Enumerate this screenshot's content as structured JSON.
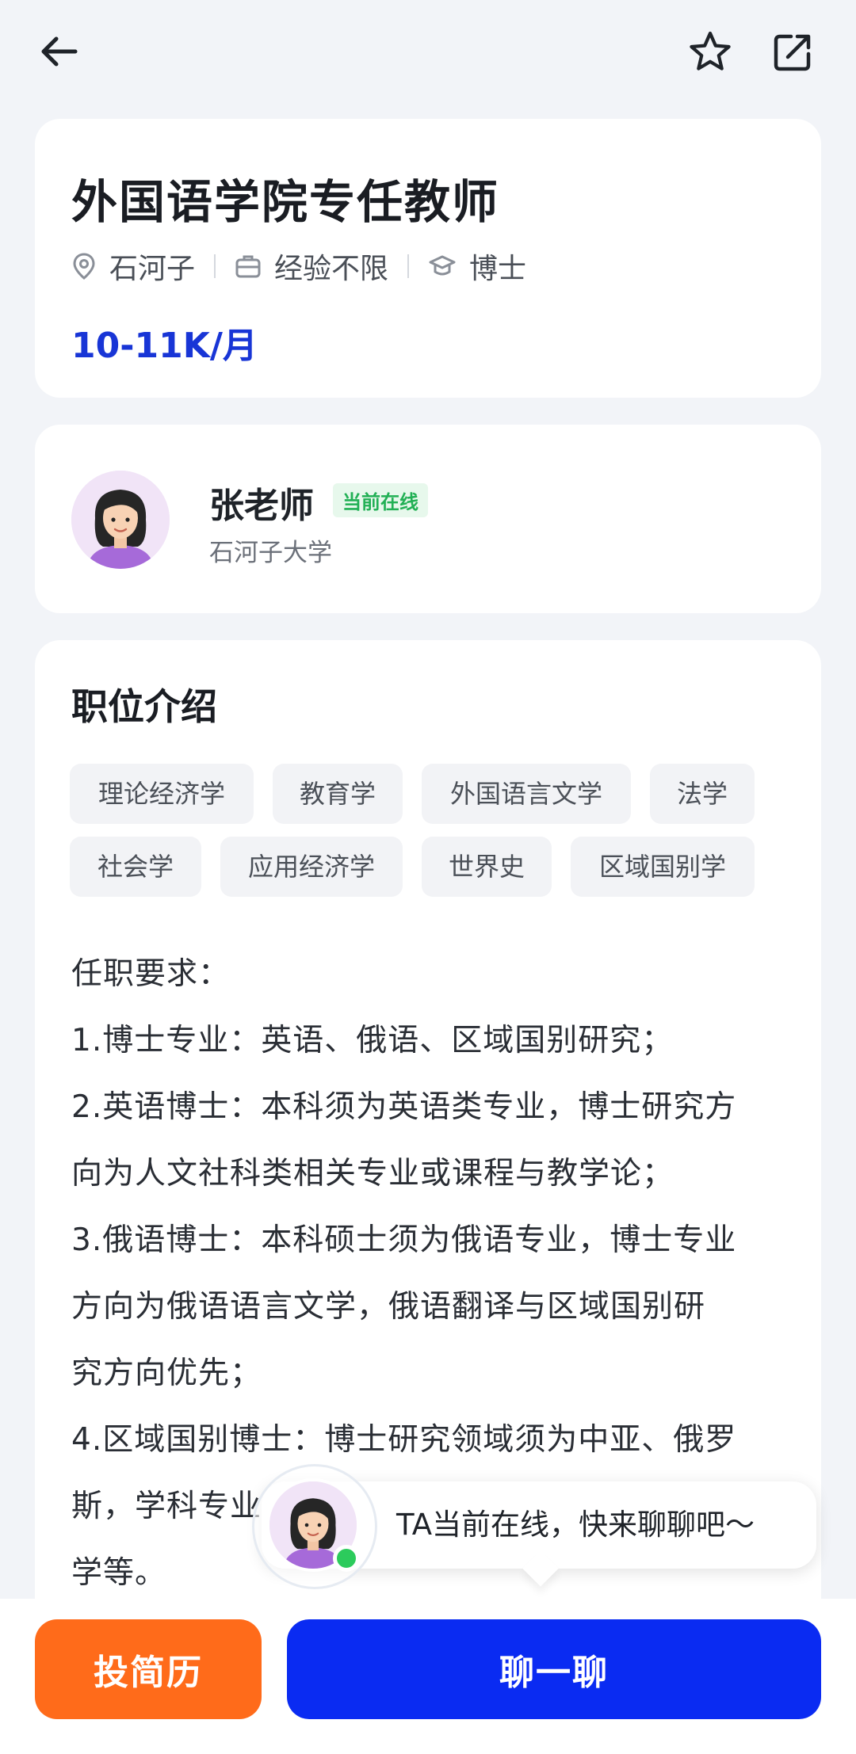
{
  "job": {
    "title": "外国语学院专任教师",
    "location": "石河子",
    "experience": "经验不限",
    "education": "博士",
    "salary": "10-11K/月"
  },
  "recruiter": {
    "name": "张老师",
    "status": "当前在线",
    "organization": "石河子大学"
  },
  "description": {
    "section_title": "职位介绍",
    "tags": [
      "理论经济学",
      "教育学",
      "外国语言文学",
      "法学",
      "社会学",
      "应用经济学",
      "世界史",
      "区域国别学"
    ],
    "lines": [
      "任职要求：",
      "1.博士专业：英语、俄语、区域国别研究；",
      "2.英语博士：本科须为英语类专业，博士研究方",
      "向为人文社科类相关专业或课程与教学论；",
      "3.俄语博士：本科硕士须为俄语专业，博士专业",
      "方向为俄语语言文学，俄语翻译与区域国别研",
      "究方向优先；",
      "4.区域国别博士：博士研究领域须为中亚、俄罗",
      "斯，学科专业",
      "学等。"
    ]
  },
  "chat_prompt": "TA当前在线，快来聊聊吧～",
  "actions": {
    "apply": "投简历",
    "chat": "聊一聊"
  },
  "colors": {
    "accent": "#1835d6",
    "primary_button": "#0a2bf2",
    "secondary_button": "#ff6b1a",
    "online": "#2ccb5c"
  },
  "icons": {
    "back": "arrow-left-icon",
    "favorite": "star-icon",
    "share": "share-icon",
    "location": "location-pin-icon",
    "experience": "briefcase-icon",
    "education": "graduation-cap-icon"
  }
}
